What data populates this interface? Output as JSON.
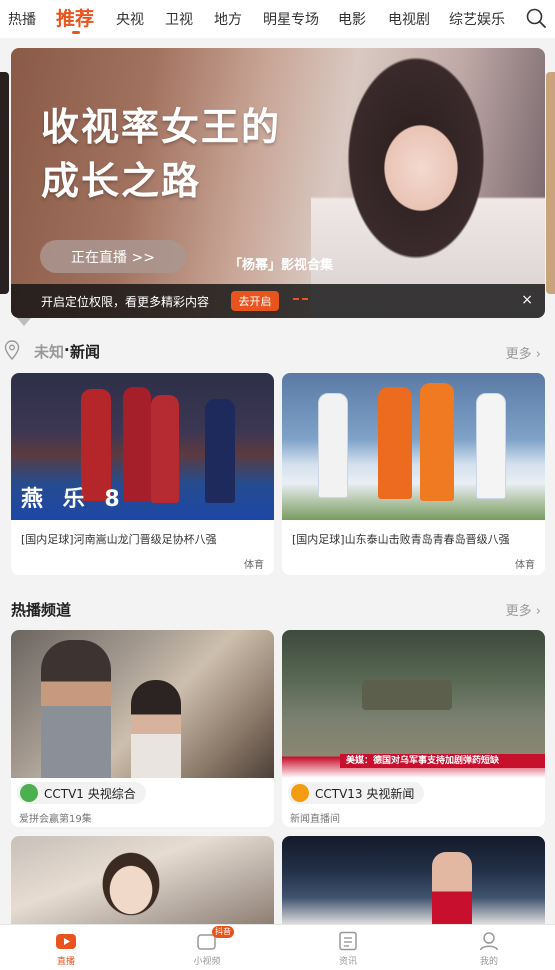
{
  "topnav": {
    "tabs": [
      "热播",
      "推荐",
      "央视",
      "卫视",
      "地方",
      "明星专场",
      "电影",
      "电视剧",
      "综艺娱乐"
    ],
    "active_index": 1
  },
  "banner": {
    "headline_line1": "收视率女王的",
    "headline_line2": "成长之路",
    "live_button": "正在直播 >>",
    "collection_label": "「杨幂」影视合集",
    "permission_msg": "开启定位权限，看更多精彩内容",
    "permission_button": "去开启",
    "close": "×"
  },
  "news_section": {
    "location": "未知",
    "dot": "·",
    "title": "新闻",
    "more": "更多 ›",
    "cards": [
      {
        "caption": "[国内足球]河南嵩山龙门晋级足协杯八强",
        "tag": "体育",
        "banner_text": "燕 乐 8"
      },
      {
        "caption": "[国内足球]山东泰山击败青岛青春岛晋级八强",
        "tag": "体育"
      }
    ]
  },
  "channel_section": {
    "title": "热播频道",
    "more": "更多 ›",
    "cards": [
      {
        "channel": "CCTV1 央视综合",
        "program": "爱拼会赢第19集",
        "logo_color": "#4caf50"
      },
      {
        "channel": "CCTV13 央视新闻",
        "program": "新闻直播间",
        "logo_color": "#f39c12",
        "ticker": "美媒：德国对乌军事支持加剧弹药短缺"
      }
    ]
  },
  "bottombar": {
    "items": [
      {
        "label": "直播",
        "active": true
      },
      {
        "label": "小视频",
        "badge": "抖音"
      },
      {
        "label": "资讯"
      },
      {
        "label": "我的"
      }
    ]
  },
  "colors": {
    "accent": "#e8541e"
  }
}
